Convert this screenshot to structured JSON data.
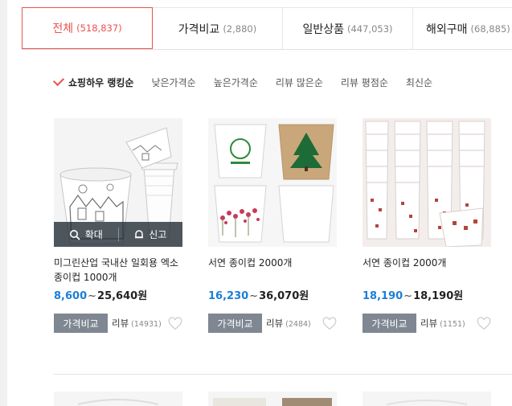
{
  "tabs": [
    {
      "label": "전체",
      "count": "(518,837)"
    },
    {
      "label": "가격비교",
      "count": "(2,880)"
    },
    {
      "label": "일반상품",
      "count": "(447,053)"
    },
    {
      "label": "해외구매",
      "count": "(68,885)"
    }
  ],
  "sort": {
    "items": [
      "쇼핑하우 랭킹순",
      "낮은가격순",
      "높은가격순",
      "리뷰 많은순",
      "리뷰 평점순",
      "최신순"
    ]
  },
  "overlay": {
    "zoom": "확대",
    "report": "신고"
  },
  "products": [
    {
      "name": "미그린산업 국내산 일회용 엑소 종이컵 1000개",
      "price_low": "8,600",
      "tilde": "~",
      "price_high": "25,640원",
      "compare": "가격비교",
      "review_label": "리뷰",
      "review_count": "(14931)"
    },
    {
      "name": "서연 종이컵 2000개",
      "price_low": "16,230",
      "tilde": "~",
      "price_high": "36,070원",
      "compare": "가격비교",
      "review_label": "리뷰",
      "review_count": "(2484)"
    },
    {
      "name": "서연 종이컵 2000개",
      "price_low": "18,190",
      "tilde": "~",
      "price_high": "18,190원",
      "compare": "가격비교",
      "review_label": "리뷰",
      "review_count": "(1151)"
    }
  ],
  "colors": {
    "accent": "#e8534f",
    "price_blue": "#1c7fd6",
    "button_gray": "#7f8792"
  },
  "icons": [
    "magnifier-icon",
    "bell-icon",
    "heart-icon",
    "check-icon"
  ]
}
